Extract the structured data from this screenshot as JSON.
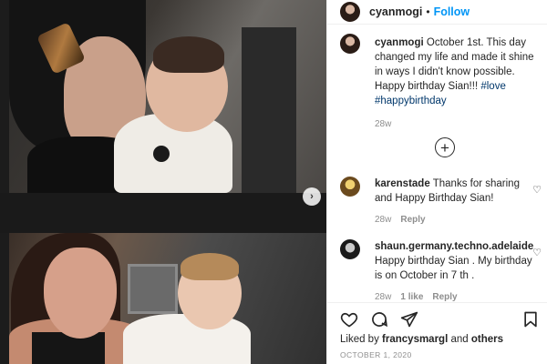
{
  "post": {
    "username": "cyanmogi",
    "separator": "•",
    "follow_label": "Follow",
    "caption": {
      "username": "cyanmogi",
      "text": "October 1st. This day changed my life and made it shine in ways I didn't know possible. Happy birthday Sian!!! ",
      "hashtags": "#love #happybirthday",
      "time": "28w"
    },
    "load_more_symbol": "+",
    "carousel_next_symbol": "›"
  },
  "comments": [
    {
      "username": "karenstade",
      "text": "Thanks for sharing and Happy Birthday Sian!",
      "time": "28w",
      "reply_label": "Reply",
      "likes_label": ""
    },
    {
      "username": "shaun.germany.techno.adelaide",
      "text": "Happy birthday Sian . My birthday is on October in 7 th .",
      "time": "28w",
      "likes_label": "1 like",
      "reply_label": "Reply"
    }
  ],
  "engagement": {
    "liked_by_prefix": "Liked by",
    "liked_by_user": "francysmargl",
    "liked_by_and": "and",
    "liked_by_others": "others",
    "date": "OCTOBER 1, 2020"
  },
  "icons": {
    "heart": "heart-icon",
    "comment": "comment-icon",
    "share": "share-icon",
    "save": "bookmark-icon",
    "add": "plus-circle-icon",
    "next": "chevron-right-icon"
  },
  "colors": {
    "accent": "#0095f6",
    "text": "#262626",
    "muted": "#8e8e8e",
    "hashtag": "#00376b"
  }
}
